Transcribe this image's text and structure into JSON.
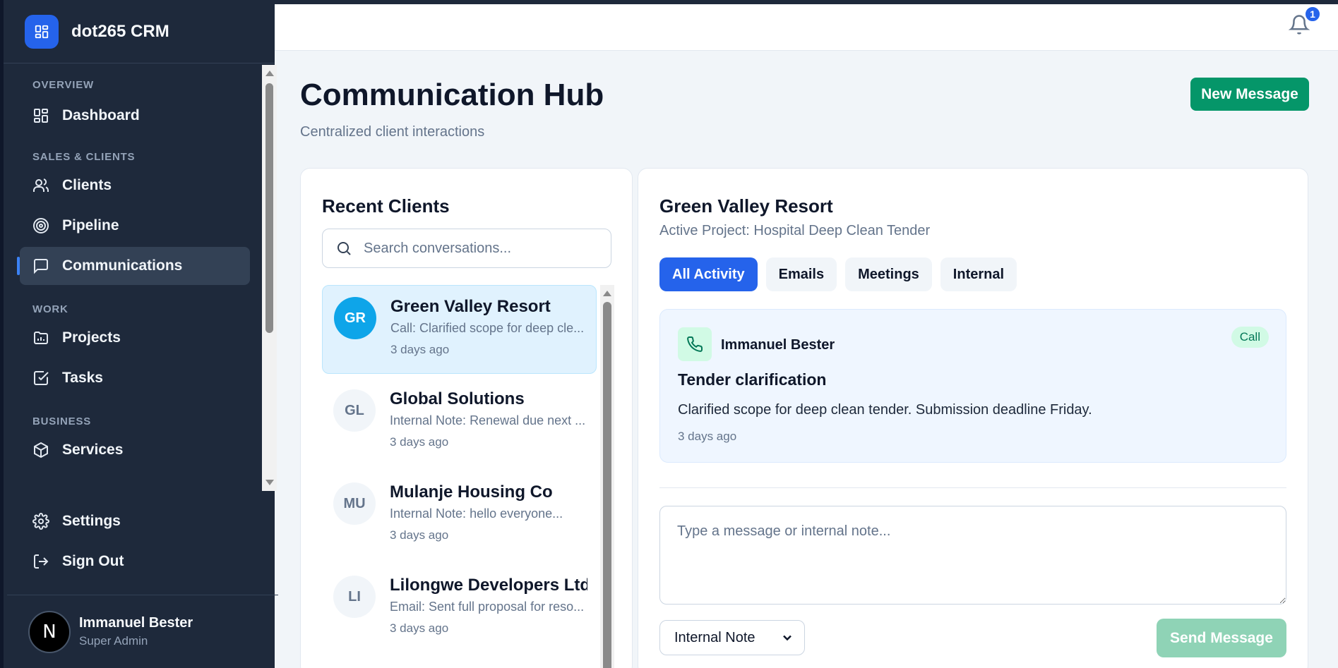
{
  "app": {
    "name": "dot265 CRM"
  },
  "nav": {
    "sections": [
      {
        "label": "OVERVIEW"
      },
      {
        "label": "SALES & CLIENTS"
      },
      {
        "label": "WORK"
      },
      {
        "label": "BUSINESS"
      }
    ],
    "items": [
      {
        "label": "Dashboard",
        "icon": "dashboard-icon"
      },
      {
        "label": "Clients",
        "icon": "users-icon"
      },
      {
        "label": "Pipeline",
        "icon": "target-icon"
      },
      {
        "label": "Communications",
        "icon": "message-icon",
        "active": true
      },
      {
        "label": "Projects",
        "icon": "folder-chart-icon"
      },
      {
        "label": "Tasks",
        "icon": "checkbox-icon"
      },
      {
        "label": "Services",
        "icon": "package-icon"
      }
    ],
    "bottom": [
      {
        "label": "Settings",
        "icon": "gear-icon"
      },
      {
        "label": "Sign Out",
        "icon": "sign-out-icon"
      }
    ]
  },
  "user": {
    "initial": "N",
    "name": "Immanuel Bester",
    "role": "Super Admin"
  },
  "notifications": {
    "count": "1"
  },
  "page": {
    "title": "Communication Hub",
    "subtitle": "Centralized client interactions",
    "new_message_label": "New Message"
  },
  "clients_panel": {
    "title": "Recent Clients",
    "search_placeholder": "Search conversations...",
    "clients": [
      {
        "initials": "GR",
        "name": "Green Valley Resort",
        "preview": "Call: Clarified scope for deep cle...",
        "time": "3 days ago",
        "active": true
      },
      {
        "initials": "GL",
        "name": "Global Solutions",
        "preview": "Internal Note: Renewal due next ...",
        "time": "3 days ago"
      },
      {
        "initials": "MU",
        "name": "Mulanje Housing Co",
        "preview": "Internal Note: hello everyone...",
        "time": "3 days ago"
      },
      {
        "initials": "LI",
        "name": "Lilongwe Developers Ltd",
        "preview": "Email: Sent full proposal for reso...",
        "time": "3 days ago"
      }
    ]
  },
  "conversation": {
    "client_name": "Green Valley Resort",
    "project": "Active Project: Hospital Deep Clean Tender",
    "tabs": [
      "All Activity",
      "Emails",
      "Meetings",
      "Internal"
    ],
    "active_tab": "All Activity",
    "activity": {
      "author": "Immanuel Bester",
      "type": "Call",
      "title": "Tender clarification",
      "body": "Clarified scope for deep clean tender. Submission deadline Friday.",
      "time": "3 days ago"
    },
    "message_placeholder": "Type a message or internal note...",
    "message_type": "Internal Note",
    "send_label": "Send Message"
  },
  "colors": {
    "sidebar": "#1e293b",
    "accent": "#2563eb",
    "success": "#059669"
  }
}
